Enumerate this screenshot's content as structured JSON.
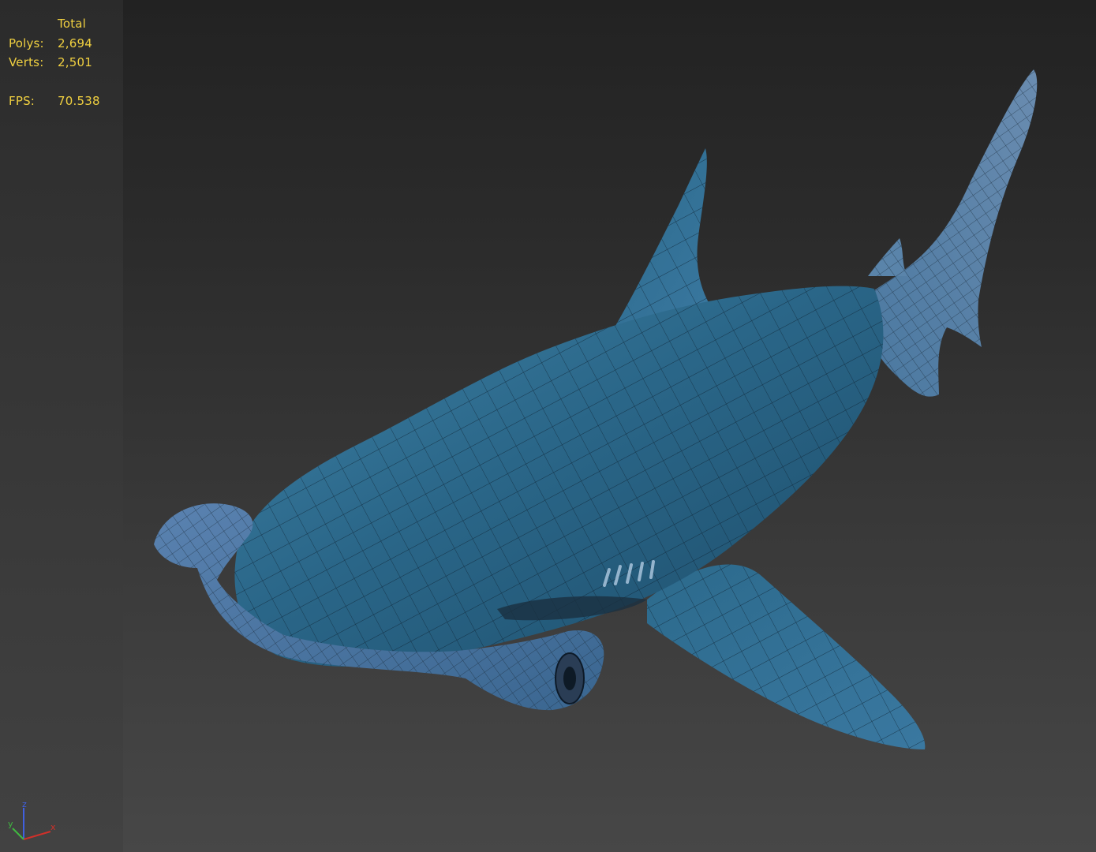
{
  "stats": {
    "header": "Total",
    "rows": [
      {
        "label": "Polys:",
        "value": "2,694"
      },
      {
        "label": "Verts:",
        "value": "2,501"
      }
    ],
    "fps": {
      "label": "FPS:",
      "value": "70.538"
    }
  },
  "axis": {
    "z": "z",
    "y": "y",
    "x": "x"
  },
  "colors": {
    "stats_text": "#f0d040",
    "shark_body": "#2f6d8c",
    "shark_light": "#5a8fb0",
    "axis_x": "#d0302a",
    "axis_y": "#40b840",
    "axis_z": "#4060e0"
  }
}
